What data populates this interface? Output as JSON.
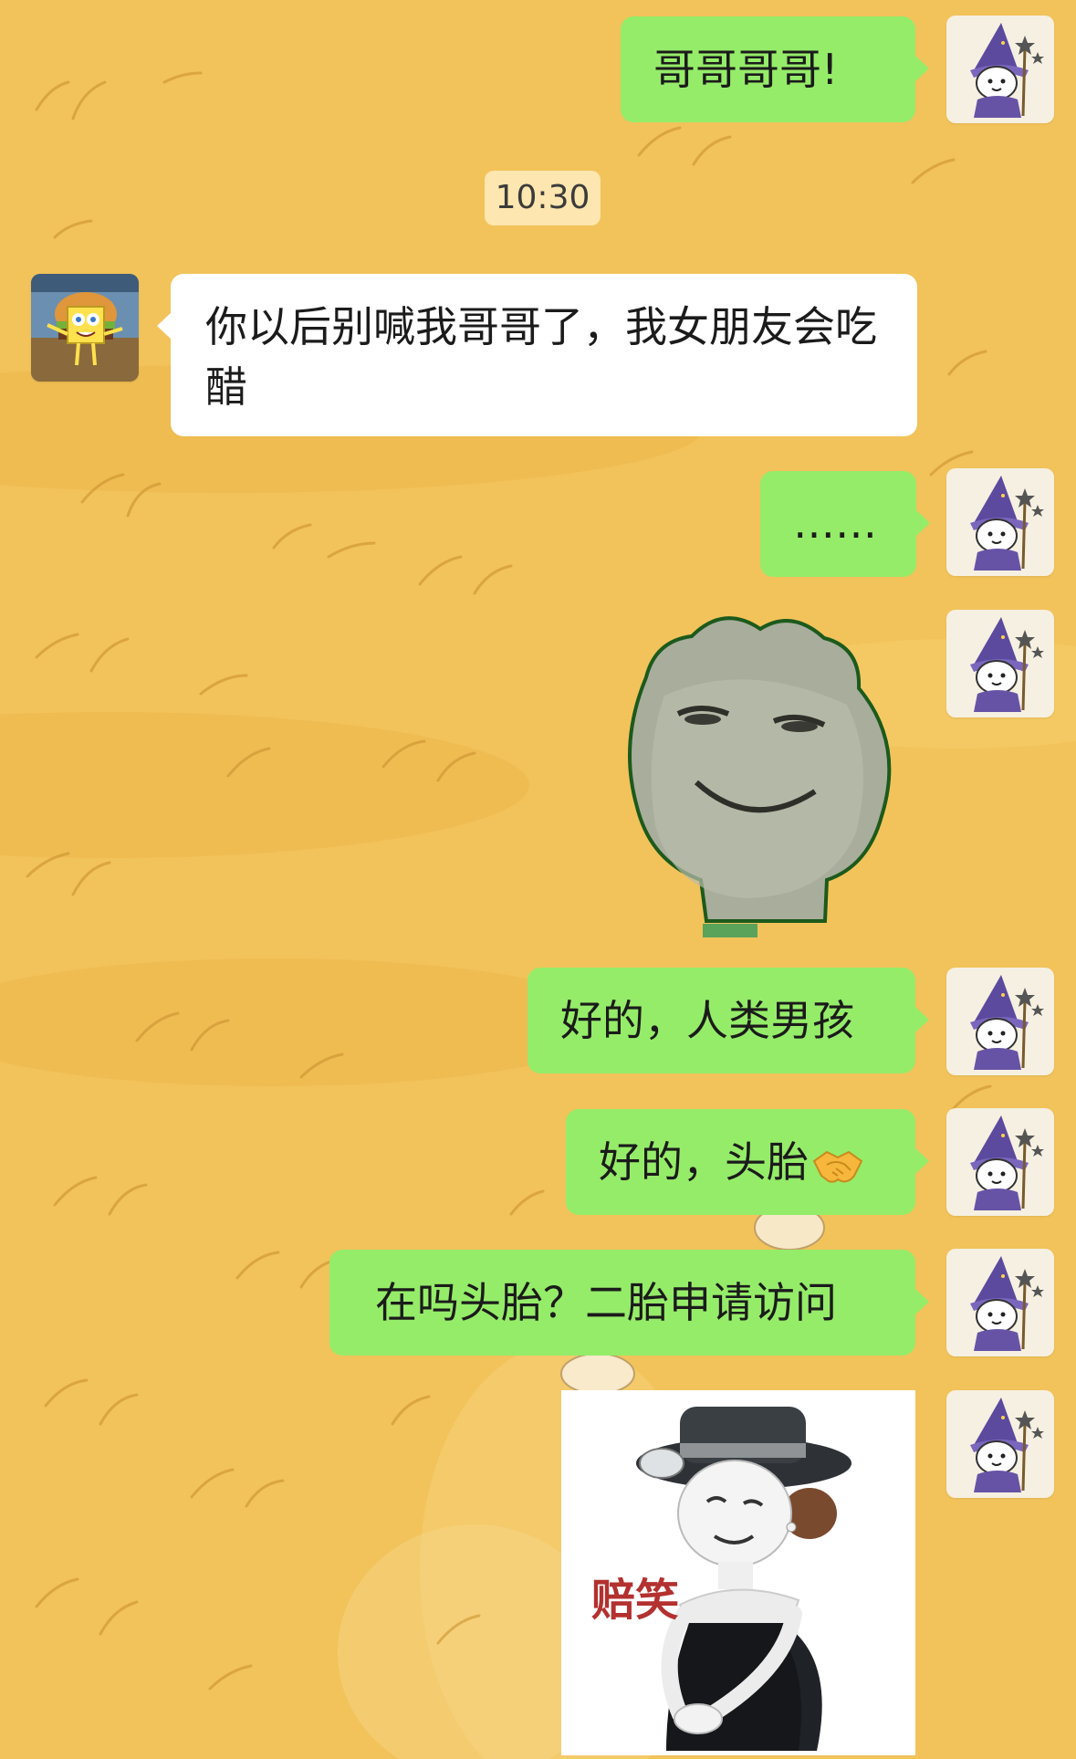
{
  "chat": {
    "timestamp": "10:30",
    "messages": [
      {
        "side": "out",
        "type": "text",
        "text": "哥哥哥哥!"
      },
      {
        "side": "in",
        "type": "text",
        "text": "你以后别喊我哥哥了，我女朋友会吃醋"
      },
      {
        "side": "out",
        "type": "text",
        "text": "……"
      },
      {
        "side": "out",
        "type": "sticker",
        "sticker": "smirking-bun-sticker"
      },
      {
        "side": "out",
        "type": "text",
        "text": "好的，人类男孩"
      },
      {
        "side": "out",
        "type": "text",
        "text": "好的，头胎",
        "emoji": "handshake-emoji"
      },
      {
        "side": "out",
        "type": "text",
        "text": "在吗头胎？二胎申请访问"
      },
      {
        "side": "out",
        "type": "sticker",
        "sticker": "bowing-lady-sticker",
        "caption": "赔笑"
      }
    ]
  },
  "colors": {
    "wallpaper": "#f2c35a",
    "outgoing_bubble": "#95ec69",
    "incoming_bubble": "#ffffff",
    "text": "#1b1b1b",
    "sticker_caption": "#b3312f"
  },
  "avatars": {
    "self": "wizard-bunny-avatar",
    "contact": "spongebob-burger-avatar"
  }
}
